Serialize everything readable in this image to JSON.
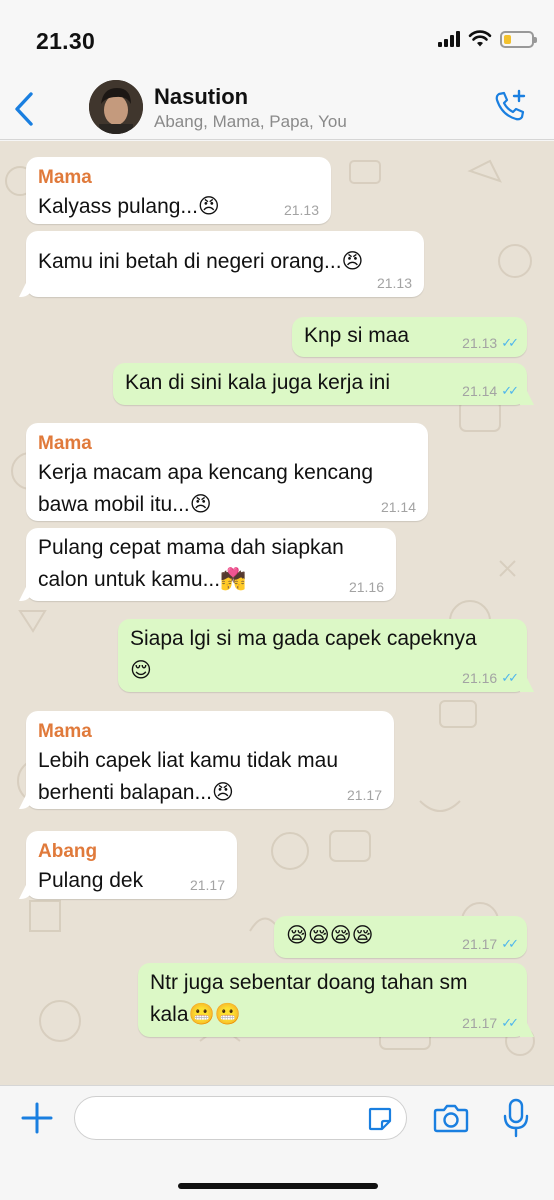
{
  "status_bar": {
    "time": "21.30",
    "battery_level": 0.25
  },
  "header": {
    "title": "Nasution",
    "members": "Abang, Mama, Papa, You",
    "back_icon": "chevron-left-icon",
    "call_icon": "add-call-icon"
  },
  "messages": [
    {
      "direction": "in",
      "sender": "Mama",
      "text": "Kalyass pulang...😠",
      "time": "21.13"
    },
    {
      "direction": "in",
      "sender": "",
      "text": "Kamu ini betah di negeri orang...😠",
      "time": "21.13"
    },
    {
      "direction": "out",
      "text": "Knp si maa",
      "time": "21.13",
      "status": "read"
    },
    {
      "direction": "out",
      "text": "Kan di sini kala juga kerja ini",
      "time": "21.14",
      "status": "read"
    },
    {
      "direction": "in",
      "sender": "Mama",
      "text_line1": "Kerja macam apa kencang kencang",
      "text_line2": "bawa mobil itu...😠",
      "time": "21.14"
    },
    {
      "direction": "in",
      "sender": "",
      "text_line1": "Pulang cepat mama dah siapkan",
      "text_line2": "calon untuk kamu...💏",
      "time": "21.16"
    },
    {
      "direction": "out",
      "text_line1": "Siapa lgi si ma gada capek capeknya",
      "text_line2": "😌",
      "time": "21.16",
      "status": "read"
    },
    {
      "direction": "in",
      "sender": "Mama",
      "text_line1": "Lebih capek liat kamu tidak mau",
      "text_line2": "berhenti balapan...😠",
      "time": "21.17"
    },
    {
      "direction": "in",
      "sender": "Abang",
      "text": "Pulang dek",
      "time": "21.17"
    },
    {
      "direction": "out",
      "text": "😪😪😪😪",
      "time": "21.17",
      "status": "read"
    },
    {
      "direction": "out",
      "text_line1": "Ntr juga sebentar doang tahan sm",
      "text_line2": "kala😬😬",
      "time": "21.17",
      "status": "read"
    }
  ],
  "input": {
    "placeholder": ""
  },
  "colors": {
    "outgoing": "#dcf8c6",
    "incoming": "#ffffff",
    "accent": "#1a7fe0",
    "sender_name": "#e07a3b",
    "read_ticks": "#4fb6ec"
  }
}
